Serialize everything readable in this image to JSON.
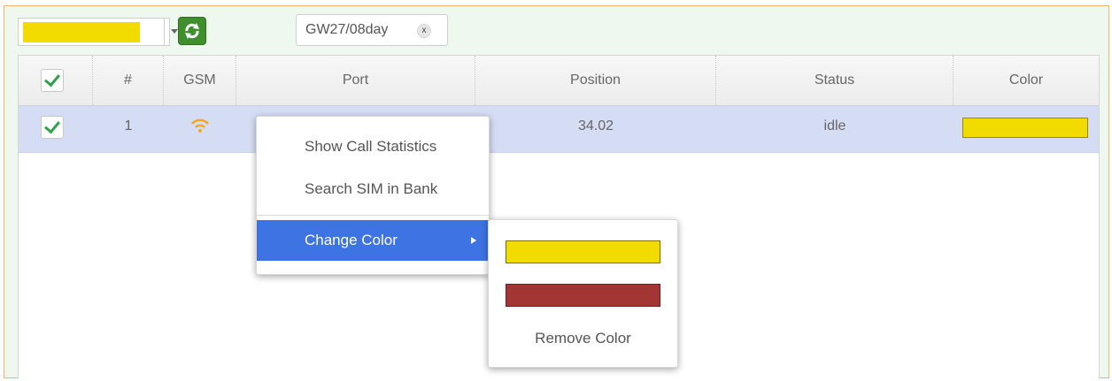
{
  "toolbar": {
    "selected_color": "#f2dc00",
    "filter_chip": {
      "label": "GW27/08day",
      "remove_symbol": "x"
    }
  },
  "grid": {
    "columns": [
      "#",
      "GSM",
      "Port",
      "Position",
      "Status",
      "Color"
    ],
    "rows": [
      {
        "checked": true,
        "number": "1",
        "gsm_icon": "wifi-signal-icon",
        "gsm_color": "#f5a623",
        "port": "",
        "position": "34.02",
        "status": "idle",
        "color": "#f2dc00"
      }
    ]
  },
  "context_menu": {
    "items": [
      {
        "label": "Show Call Statistics"
      },
      {
        "label": "Search SIM in Bank"
      },
      {
        "label": "Change Color",
        "active": true
      }
    ],
    "submenu": {
      "colors": [
        "#f2dc00",
        "#a33535"
      ],
      "remove_label": "Remove Color"
    }
  },
  "colors": {
    "accent": "#3d73e2",
    "refresh_button": "#3f8f2d",
    "check": "#2fa14a",
    "frame_border": "#f0b46a",
    "selected_row": "#d5ddf5"
  }
}
